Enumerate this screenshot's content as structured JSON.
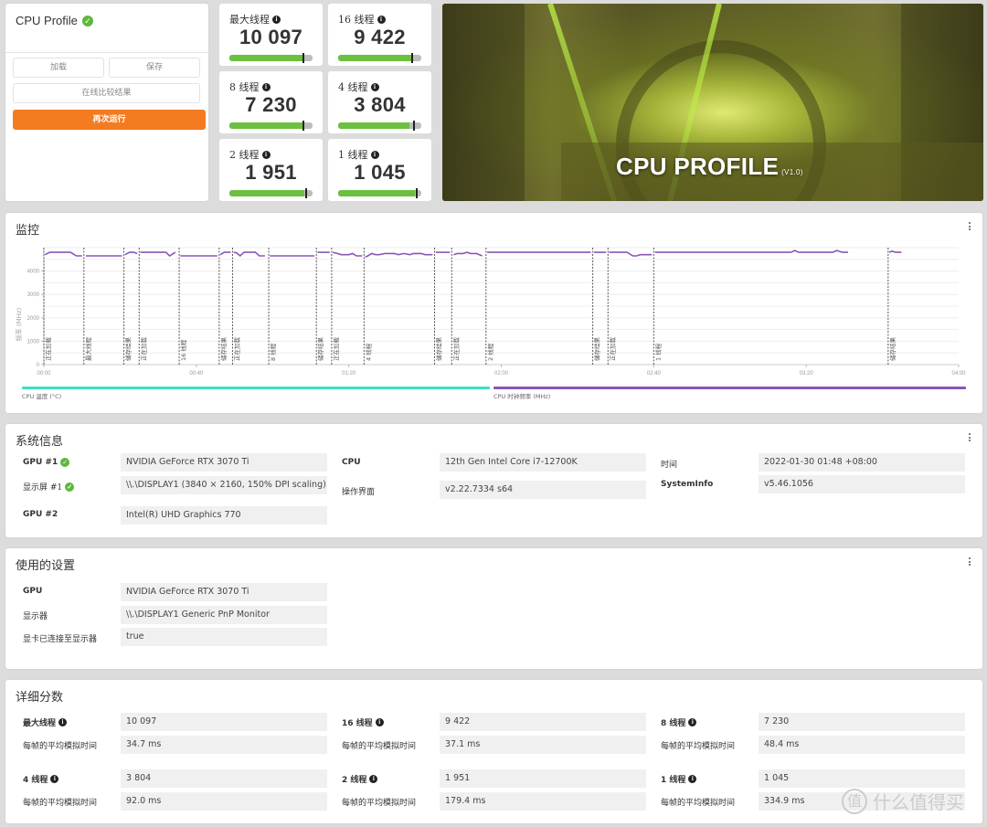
{
  "profile": {
    "title": "CPU Profile",
    "status_icon": "check-circle-icon",
    "buttons": {
      "load": "加载",
      "save": "保存",
      "compare_online": "在线比较结果",
      "run_again": "再次运行"
    }
  },
  "tiles": [
    {
      "label": "最大线程",
      "value": "10 097",
      "bar_fill": 0.88,
      "marker": 0.88
    },
    {
      "label": "16 线程",
      "value": "9 422",
      "bar_fill": 0.88,
      "marker": 0.88
    },
    {
      "label": "8 线程",
      "value": "7 230",
      "bar_fill": 0.88,
      "marker": 0.88
    },
    {
      "label": "4 线程",
      "value": "3 804",
      "bar_fill": 0.86,
      "marker": 0.9
    },
    {
      "label": "2 线程",
      "value": "1 951",
      "bar_fill": 0.9,
      "marker": 0.91
    },
    {
      "label": "1 线程",
      "value": "1 045",
      "bar_fill": 0.92,
      "marker": 0.93
    }
  ],
  "banner": {
    "title": "CPU PROFILE",
    "version": "(V1.0)"
  },
  "monitor": {
    "title": "监控",
    "menu_icon": "kebab-menu-icon",
    "legend": [
      {
        "label": "CPU 温度 (°C)",
        "color": "#3fe0c0"
      },
      {
        "label": "CPU 时钟频率 (MHz)",
        "color": "#8a55b8"
      }
    ]
  },
  "chart_data": {
    "type": "line",
    "ylabel": "频率 (MHz)",
    "ylim": [
      0,
      5000
    ],
    "yticks": [
      0,
      1000,
      2000,
      3000,
      4000
    ],
    "xlim_seconds": [
      0,
      240
    ],
    "xticks": [
      "00:00",
      "00:40",
      "01:20",
      "02:00",
      "02:40",
      "03:20",
      "04:00"
    ],
    "grid": true,
    "markers": [
      {
        "t": 0,
        "label": "正在加载"
      },
      {
        "t": 10.5,
        "label": "最大线程"
      },
      {
        "t": 21,
        "label": "储存结果"
      },
      {
        "t": 25,
        "label": "正在加载"
      },
      {
        "t": 35.5,
        "label": "16 线程"
      },
      {
        "t": 46,
        "label": "储存结果"
      },
      {
        "t": 49.5,
        "label": "正在加载"
      },
      {
        "t": 59,
        "label": "8 线程"
      },
      {
        "t": 71.5,
        "label": "储存结果"
      },
      {
        "t": 75.5,
        "label": "正在加载"
      },
      {
        "t": 84,
        "label": "4 线程"
      },
      {
        "t": 102.5,
        "label": "储存结果"
      },
      {
        "t": 107,
        "label": "正在加载"
      },
      {
        "t": 116,
        "label": "2 线程"
      },
      {
        "t": 144,
        "label": "储存结果"
      },
      {
        "t": 148,
        "label": "正在加载"
      },
      {
        "t": 160,
        "label": "1 线程"
      },
      {
        "t": 221.5,
        "label": "储存结果"
      }
    ],
    "series": [
      {
        "name": "CPU 时钟频率 (MHz)",
        "segments": [
          [
            [
              0.3,
              4700
            ],
            [
              1.5,
              4800
            ],
            [
              7,
              4800
            ],
            [
              8.5,
              4650
            ],
            [
              10,
              4650
            ]
          ],
          [
            [
              11,
              4650
            ],
            [
              20.5,
              4650
            ]
          ],
          [
            [
              21.3,
              4700
            ],
            [
              22.5,
              4800
            ],
            [
              23.5,
              4800
            ],
            [
              24.5,
              4750
            ]
          ],
          [
            [
              25.3,
              4800
            ],
            [
              32,
              4800
            ],
            [
              33,
              4650
            ],
            [
              34.5,
              4800
            ]
          ],
          [
            [
              35.8,
              4650
            ],
            [
              45.5,
              4650
            ]
          ],
          [
            [
              46.3,
              4700
            ],
            [
              47.3,
              4800
            ],
            [
              49,
              4800
            ]
          ],
          [
            [
              49.8,
              4800
            ],
            [
              50.5,
              4780
            ],
            [
              51.5,
              4650
            ],
            [
              52.5,
              4800
            ],
            [
              55.5,
              4800
            ],
            [
              56.5,
              4650
            ],
            [
              58,
              4650
            ]
          ],
          [
            [
              59.3,
              4650
            ],
            [
              71,
              4650
            ]
          ],
          [
            [
              71.8,
              4800
            ],
            [
              75,
              4800
            ]
          ],
          [
            [
              75.8,
              4800
            ],
            [
              77,
              4750
            ],
            [
              78,
              4700
            ],
            [
              80,
              4700
            ],
            [
              81,
              4750
            ],
            [
              82,
              4650
            ],
            [
              83.5,
              4650
            ]
          ],
          [
            [
              84.3,
              4600
            ],
            [
              85,
              4650
            ],
            [
              86,
              4750
            ],
            [
              87,
              4700
            ],
            [
              88,
              4700
            ],
            [
              89.5,
              4750
            ],
            [
              92,
              4750
            ],
            [
              93,
              4700
            ],
            [
              94.5,
              4750
            ],
            [
              96,
              4700
            ],
            [
              97,
              4750
            ],
            [
              99,
              4750
            ],
            [
              100,
              4700
            ],
            [
              102,
              4700
            ]
          ],
          [
            [
              102.8,
              4800
            ],
            [
              106.5,
              4800
            ]
          ],
          [
            [
              107.5,
              4700
            ],
            [
              108.5,
              4750
            ],
            [
              110,
              4750
            ],
            [
              111,
              4800
            ],
            [
              112,
              4750
            ],
            [
              113.5,
              4750
            ],
            [
              115,
              4650
            ]
          ],
          [
            [
              116.3,
              4800
            ],
            [
              143.5,
              4800
            ]
          ],
          [
            [
              144.3,
              4800
            ],
            [
              147.5,
              4800
            ]
          ],
          [
            [
              148.3,
              4800
            ],
            [
              153,
              4800
            ],
            [
              154.5,
              4650
            ],
            [
              155.5,
              4650
            ],
            [
              156.5,
              4700
            ],
            [
              159.5,
              4700
            ]
          ],
          [
            [
              160.3,
              4800
            ],
            [
              196,
              4800
            ],
            [
              197,
              4880
            ],
            [
              198,
              4800
            ],
            [
              207,
              4800
            ],
            [
              208,
              4880
            ],
            [
              209.5,
              4800
            ],
            [
              211,
              4800
            ]
          ],
          [
            [
              221.8,
              4800
            ],
            [
              222.5,
              4850
            ],
            [
              223.5,
              4800
            ],
            [
              225,
              4800
            ]
          ]
        ]
      },
      {
        "name": "CPU 温度 (°C)",
        "segments": []
      }
    ]
  },
  "sysinfo": {
    "title": "系统信息",
    "rows_left": [
      {
        "label": "GPU #1",
        "value": "NVIDIA GeForce RTX 3070 Ti",
        "check": true,
        "bold": true
      },
      {
        "label": "显示屏 #1",
        "value": "\\\\.\\DISPLAY1 (3840 × 2160, 150% DPI scaling)",
        "check": true,
        "bold": false
      },
      {
        "label": "GPU #2",
        "value": "Intel(R) UHD Graphics 770",
        "check": false,
        "bold": true
      }
    ],
    "rows_mid": [
      {
        "label": "CPU",
        "value": "12th Gen Intel Core i7-12700K",
        "bold": true
      },
      {
        "label": "操作界面",
        "value": "v2.22.7334 s64",
        "bold": false
      }
    ],
    "rows_right": [
      {
        "label": "时间",
        "value": "2022-01-30 01:48 +08:00",
        "bold": false
      },
      {
        "label": "SystemInfo",
        "value": "v5.46.1056",
        "bold": true
      }
    ]
  },
  "settings": {
    "title": "使用的设置",
    "rows": [
      {
        "label": "GPU",
        "value": "NVIDIA GeForce RTX 3070 Ti",
        "bold": true
      },
      {
        "label": "显示器",
        "value": "\\\\.\\DISPLAY1 Generic PnP Monitor",
        "bold": false
      },
      {
        "label": "显卡已连接至显示器",
        "value": "true",
        "bold": false
      }
    ]
  },
  "details": {
    "title": "详细分数",
    "time_label": "每帧的平均模拟时间",
    "groups": [
      {
        "label": "最大线程",
        "score": "10 097",
        "time": "34.7 ms"
      },
      {
        "label": "16 线程",
        "score": "9 422",
        "time": "37.1 ms"
      },
      {
        "label": "8 线程",
        "score": "7 230",
        "time": "48.4 ms"
      },
      {
        "label": "4 线程",
        "score": "3 804",
        "time": "92.0 ms"
      },
      {
        "label": "2 线程",
        "score": "1 951",
        "time": "179.4 ms"
      },
      {
        "label": "1 线程",
        "score": "1 045",
        "time": "334.9 ms"
      }
    ]
  },
  "watermark": {
    "circle": "值",
    "text": "什么值得买"
  }
}
